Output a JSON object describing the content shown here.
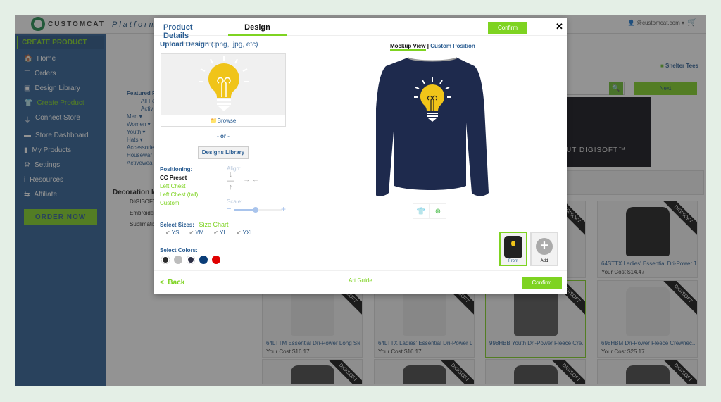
{
  "header": {
    "brand": "CUSTOMCAT",
    "platform": "Platform",
    "user": "@customcat.com ▾"
  },
  "sidebar": {
    "section": "CREATE PRODUCT",
    "items": [
      {
        "icon": "🏠",
        "label": "Home"
      },
      {
        "icon": "☰",
        "label": "Orders"
      },
      {
        "icon": "▣",
        "label": "Design Library"
      },
      {
        "icon": "👕",
        "label": "Create Product",
        "active": true
      },
      {
        "icon": "⏚",
        "label": "Connect Store"
      },
      {
        "icon": "▬",
        "label": "Store Dashboard"
      },
      {
        "icon": "▮",
        "label": "My Products"
      },
      {
        "icon": "⚙",
        "label": "Settings"
      },
      {
        "icon": "i",
        "label": "Resources"
      },
      {
        "icon": "⇆",
        "label": "Affiliate"
      }
    ],
    "order_now": "ORDER NOW"
  },
  "filters": [
    "Featured P",
    "All Fe",
    "Activ",
    "Men ▾",
    "Women ▾",
    "Youth ▾",
    "Hats ▾",
    "Accessorie",
    "Housewar",
    "Activewea"
  ],
  "decoration": {
    "title": "Decoration M",
    "items": [
      "DIGISOFT™",
      "Embroidery",
      "Sublimation"
    ]
  },
  "store": "Shelter Tees",
  "next": "Next",
  "banner": "UT DIGISOFT™",
  "products": [
    {
      "name": "",
      "price": "",
      "tag": "DIGISOFT"
    },
    {
      "name": "",
      "price": "",
      "tag": "DIGISOFT"
    },
    {
      "name": "",
      "price": "",
      "tag": "DIGISOFT"
    },
    {
      "name": "64STTX Ladies' Essential Dri-Power T...",
      "price": "Your Cost $14.47",
      "tag": "DIGISOFT"
    },
    {
      "name": "64LTTM Essential Dri-Power Long Sle...",
      "price": "Your Cost $16.17",
      "tag": "DIGISOFT"
    },
    {
      "name": "64LTTX Ladies' Essential Dri-Power L...",
      "price": "Your Cost $16.17",
      "tag": "DIGISOFT"
    },
    {
      "name": "998HBB Youth Dri-Power Fleece Cre...",
      "price": "",
      "tag": "DIGISOFT"
    },
    {
      "name": "698HBM Dri-Power Fleece Crewnec...",
      "price": "Your Cost $25.17",
      "tag": "DIGISOFT"
    },
    {
      "name": "",
      "price": "",
      "tag": "DIGISOFT"
    },
    {
      "name": "",
      "price": "",
      "tag": "DIGISOFT"
    },
    {
      "name": "",
      "price": "",
      "tag": "DIGISOFT"
    },
    {
      "name": "",
      "price": "",
      "tag": "DIGISOFT"
    }
  ],
  "modal": {
    "tabs": [
      "Product Details",
      "Design"
    ],
    "confirm": "Confirm",
    "close": "✕",
    "upload_title": "Upload Design",
    "upload_hint": "(.png, .jpg, etc)",
    "browse": "Browse",
    "or": "- or -",
    "designs_library": "Designs Library",
    "positioning_label": "Positioning:",
    "positions": [
      "CC Preset",
      "Left Chest",
      "Left Chest (tall)",
      "Custom"
    ],
    "align_label": "Align:",
    "scale_label": "Scale:",
    "scale_value": 0.45,
    "sizes_label": "Select Sizes:",
    "size_chart": "Size Chart",
    "sizes": [
      "YS",
      "YM",
      "YL",
      "YXL"
    ],
    "colors_label": "Select Colors:",
    "colors": [
      "#2b2b2b",
      "#bdbdbd",
      "#2c2f45",
      "#0a3d78",
      "#e00000"
    ],
    "views": [
      "Mockup View",
      "Custom Position"
    ],
    "view_sep": "|",
    "thumbs": [
      "Front",
      "Add"
    ],
    "back": "Back",
    "art_guide": "Art Guide",
    "accent": "#7ed321",
    "shirt_color": "#1e2a4d"
  }
}
